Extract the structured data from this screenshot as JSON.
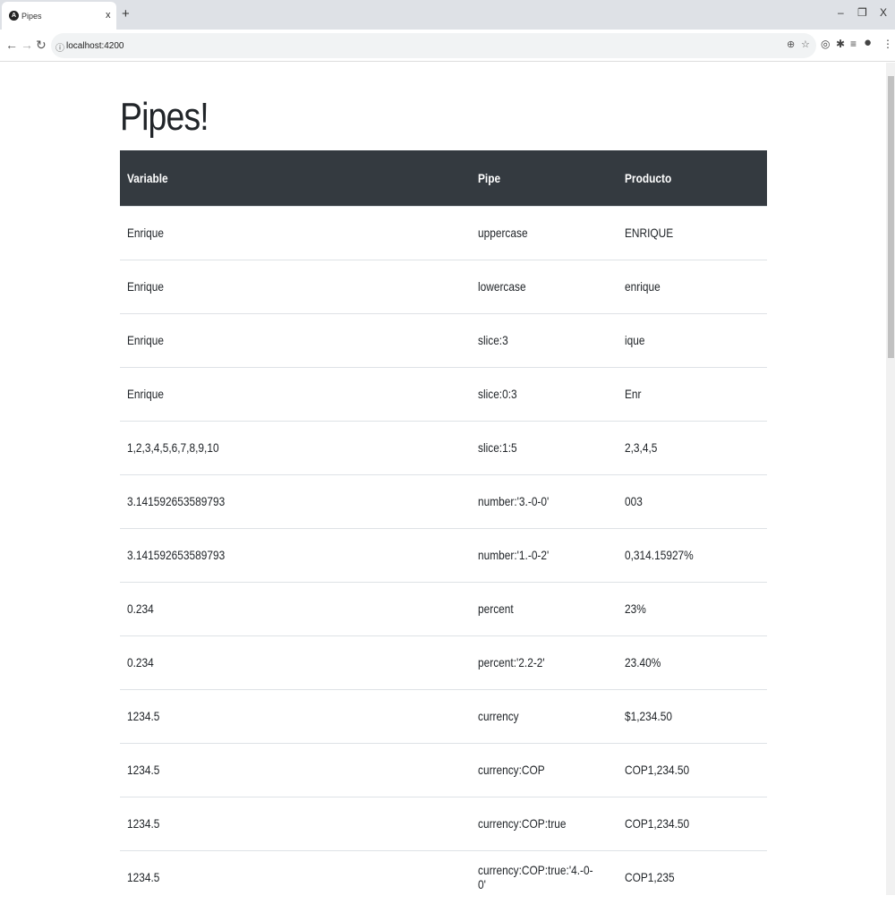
{
  "browser": {
    "tab_title": "Pipes",
    "tab_close": "x",
    "new_tab": "+",
    "url": "localhost:4200",
    "minimize": "–",
    "restore": "❐",
    "close": "X"
  },
  "page": {
    "title": "Pipes!"
  },
  "table": {
    "headers": [
      "Variable",
      "Pipe",
      "Producto"
    ],
    "rows": [
      [
        "Enrique",
        "uppercase",
        "ENRIQUE"
      ],
      [
        "Enrique",
        "lowercase",
        "enrique"
      ],
      [
        "Enrique",
        "slice:3",
        "ique"
      ],
      [
        "Enrique",
        "slice:0:3",
        "Enr"
      ],
      [
        "1,2,3,4,5,6,7,8,9,10",
        "slice:1:5",
        "2,3,4,5"
      ],
      [
        "3.141592653589793",
        "number:'3.-0-0'",
        "003"
      ],
      [
        "3.141592653589793",
        "number:'1.-0-2'",
        "0,314.15927%"
      ],
      [
        "0.234",
        "percent",
        "23%"
      ],
      [
        "0.234",
        "percent:'2.2-2'",
        "23.40%"
      ],
      [
        "1234.5",
        "currency",
        "$1,234.50"
      ],
      [
        "1234.5",
        "currency:COP",
        "COP1,234.50"
      ],
      [
        "1234.5",
        "currency:COP:true",
        "COP1,234.50"
      ],
      [
        "1234.5",
        "currency:COP:true:'4.-0-0'",
        "COP1,235"
      ]
    ]
  },
  "colors": {
    "header_bg": "#343a40",
    "header_text": "#ffffff",
    "row_border": "#dee2e6"
  }
}
